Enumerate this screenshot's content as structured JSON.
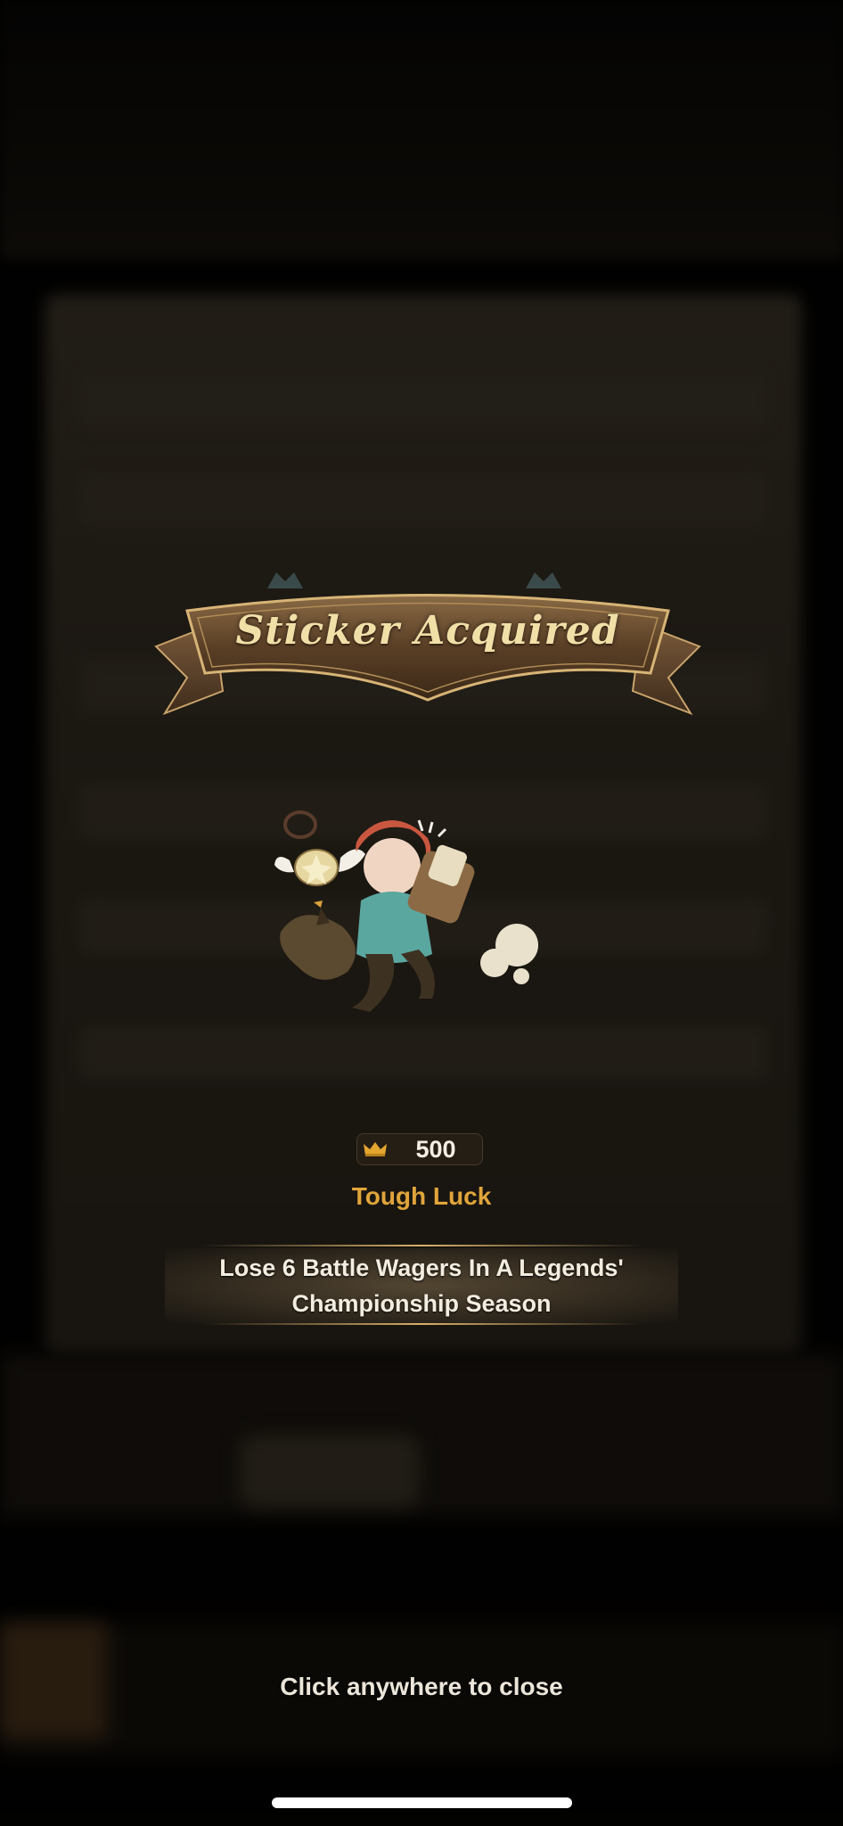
{
  "banner": {
    "title": "Sticker Acquired"
  },
  "sticker": {
    "icon": "sticker-illustration"
  },
  "reward": {
    "icon": "crown-icon",
    "value": "500"
  },
  "achievement": {
    "name": "Tough Luck",
    "description_line1": "Lose 6 Battle Wagers In A Legends'",
    "description_line2": "Championship Season"
  },
  "footer": {
    "close_hint": "Click anywhere to close"
  },
  "colors": {
    "title": "#f1dfa8",
    "name": "#e0a53b",
    "text": "#f3ede0"
  }
}
